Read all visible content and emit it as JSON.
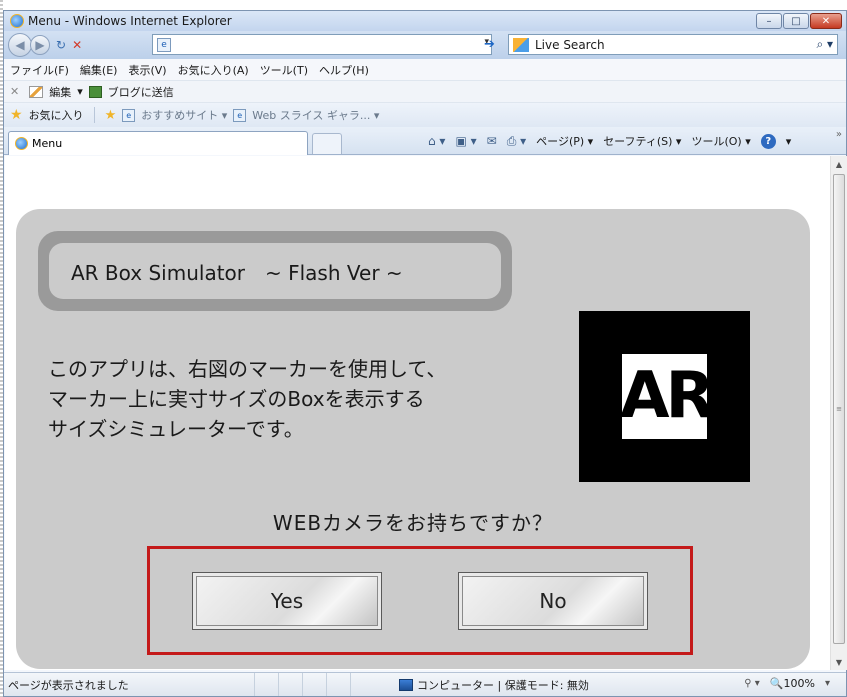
{
  "window": {
    "title": "Menu - Windows Internet Explorer",
    "minimize": "–",
    "maximize": "□",
    "close": "✕"
  },
  "address": {
    "page_icon": "e",
    "value": "",
    "dropdown": "▾",
    "go": "➔"
  },
  "search": {
    "placeholder": "Live Search",
    "button": "⌕ ▾"
  },
  "menubar": [
    "ファイル(F)",
    "編集(E)",
    "表示(V)",
    "お気に入り(A)",
    "ツール(T)",
    "ヘルプ(H)"
  ],
  "linksbar": {
    "close": "✕",
    "edit": "編集",
    "edit_dropdown": "▾",
    "blog": "ブログに送信"
  },
  "favorites": {
    "label": "お気に入り",
    "suggested": "おすすめサイト ▾",
    "webslice": "Web スライス ギャラ... ▾"
  },
  "tab": {
    "label": "Menu"
  },
  "commands": {
    "home": "⌂ ▾",
    "feeds": "▣ ▾",
    "mail": "✉",
    "print": "⎙ ▾",
    "page": "ページ(P) ▾",
    "safety": "セーフティ(S) ▾",
    "tools": "ツール(O) ▾",
    "help": "?",
    "help_dropdown": "▾",
    "more": "»"
  },
  "app": {
    "title": "AR Box Simulator　~ Flash Ver ~",
    "description": [
      "このアプリは、右図のマーカーを使用して、",
      "マーカー上に実寸サイズのBoxを表示する",
      "サイズシミュレーターです。"
    ],
    "marker_text": "AR",
    "question": "WEBカメラをお持ちですか？",
    "yes": "Yes",
    "no": "No",
    "highlight_color": "#c41a1a"
  },
  "scrollbar": {
    "up": "▲",
    "down": "▼",
    "grip": "≡"
  },
  "status": {
    "text": "ページが表示されました",
    "zone": "コンピューター | 保護モード: 無効",
    "security_icon": "⚲ ▾",
    "zoom": "🔍100%",
    "zoom_dropdown": "▾"
  }
}
